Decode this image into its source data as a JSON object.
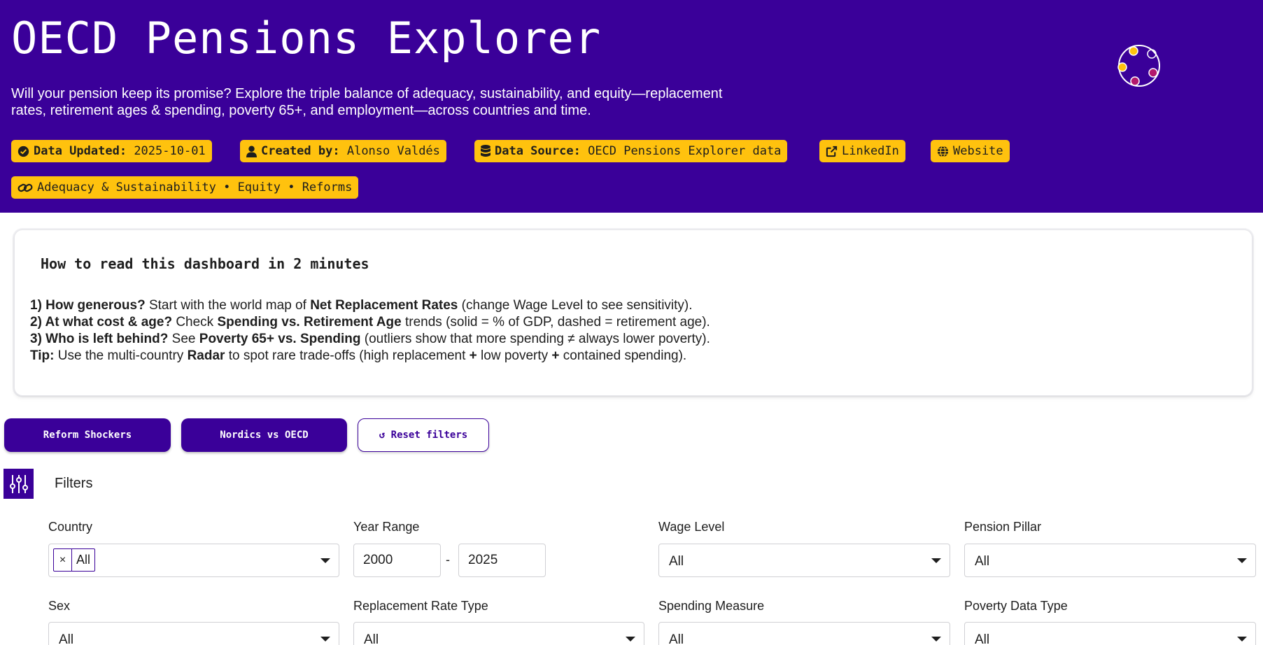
{
  "header": {
    "title": "OECD Pensions Explorer",
    "subtitle": "Will your pension keep its promise? Explore the triple balance of adequacy, sustainability, and equity—replacement rates, retirement ages & spending, poverty 65+, and employment—across countries and time.",
    "colors": {
      "background": "#3a0099",
      "badge": "#ffc20e",
      "logo_dot_yellow": "#ffc20e",
      "logo_dot_magenta": "#b3186d"
    }
  },
  "badges": {
    "updated": {
      "icon": "check-circle-icon",
      "label": "Data Updated:",
      "value": "2025-10-01"
    },
    "created": {
      "icon": "user-icon",
      "label": "Created by:",
      "value": "Alonso Valdés"
    },
    "source": {
      "icon": "database-icon",
      "label": "Data Source:",
      "value": "OECD Pensions Explorer data"
    },
    "linkedin": {
      "icon": "external-link-icon",
      "label": "LinkedIn"
    },
    "website": {
      "icon": "globe-icon",
      "label": "Website"
    },
    "topics": {
      "icon": "link-icon",
      "label": "Adequacy & Sustainability • Equity • Reforms"
    }
  },
  "guide": {
    "title": "How to read this dashboard in 2 minutes",
    "line1": {
      "lead": "1) How generous?",
      "t1": " Start with the world map of ",
      "b1": "Net Replacement Rates",
      "t2": " (change Wage Level to see sensitivity)."
    },
    "line2": {
      "lead": "2) At what cost & age?",
      "t1": " Check ",
      "b1": "Spending vs. Retirement Age",
      "t2": " trends (solid = % of GDP, dashed = retirement age)."
    },
    "line3": {
      "lead": "3) Who is left behind?",
      "t1": " See ",
      "b1": "Poverty 65+ vs. Spending",
      "t2": " (outliers show that more spending ≠ always lower poverty)."
    },
    "line4": {
      "lead": "Tip:",
      "t1": " Use the multi-country ",
      "b1": "Radar",
      "t2": " to spot rare trade-offs (high replacement ",
      "b2": "+",
      "t3": " low poverty ",
      "b3": "+",
      "t4": " contained spending)."
    }
  },
  "presets": {
    "reform_shockers": "Reform Shockers",
    "nordics": "Nordics vs OECD",
    "reset": "↺ Reset filters"
  },
  "filters": {
    "title": "Filters",
    "icon": "sliders-icon",
    "country": {
      "label": "Country",
      "chip": "All",
      "chip_remove": "×"
    },
    "year_range": {
      "label": "Year Range",
      "from": "2000",
      "separator": "-",
      "to": "2025"
    },
    "wage_level": {
      "label": "Wage Level",
      "value": "All"
    },
    "pension_pillar": {
      "label": "Pension Pillar",
      "value": "All"
    },
    "sex": {
      "label": "Sex",
      "value": "All"
    },
    "replacement_rate_type": {
      "label": "Replacement Rate Type",
      "value": "All"
    },
    "spending_measure": {
      "label": "Spending Measure",
      "value": "All"
    },
    "poverty_data_type": {
      "label": "Poverty Data Type",
      "value": "All"
    }
  }
}
